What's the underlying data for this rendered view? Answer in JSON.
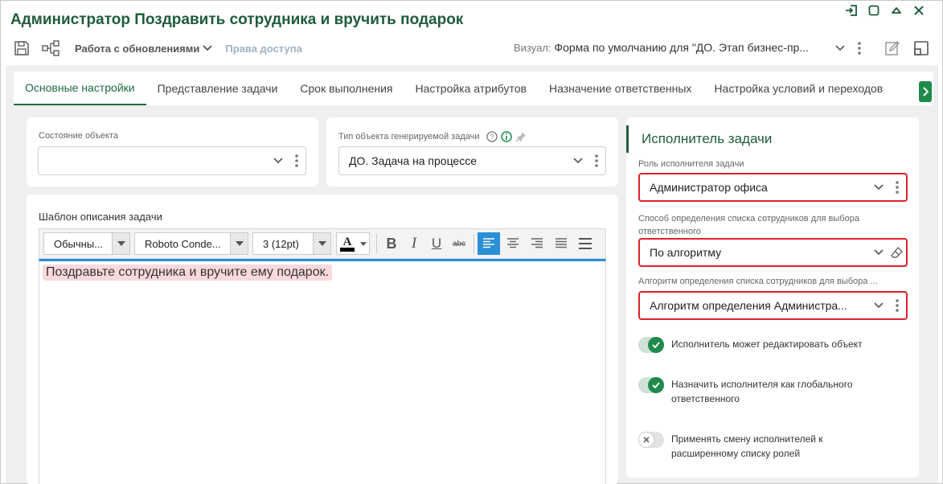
{
  "window": {
    "title": "Администратор Поздравить сотрудника и вручить подарок"
  },
  "toolbar": {
    "updates_menu": "Работа с обновлениями",
    "access_rights": "Права доступа",
    "visual_label": "Визуал:",
    "visual_value": "Форма по умолчанию для \"ДО. Этап бизнес-пр..."
  },
  "tabs": [
    {
      "label": "Основные настройки",
      "active": true
    },
    {
      "label": "Представление задачи",
      "active": false
    },
    {
      "label": "Срок выполнения",
      "active": false
    },
    {
      "label": "Настройка атрибутов",
      "active": false
    },
    {
      "label": "Назначение ответственных",
      "active": false
    },
    {
      "label": "Настройка условий и переходов",
      "active": false
    }
  ],
  "object_state": {
    "label": "Состояние объекта",
    "value": ""
  },
  "task_type": {
    "label": "Тип объекта генерируемой задачи",
    "value": "ДО. Задача на процессе"
  },
  "template": {
    "label": "Шаблон описания задачи",
    "style_value": "Обычны...",
    "font_value": "Roboto Conde...",
    "size_value": "3 (12pt)",
    "text": "Поздравьте сотрудника и вручите ему подарок."
  },
  "executor": {
    "title": "Исполнитель задачи",
    "role_label": "Роль исполнителя задачи",
    "role_value": "Администратор офиса",
    "method_label_line1": "Способ определения списка сотрудников для выбора",
    "method_label_line2": "ответственного",
    "method_value": "По алгоритму",
    "algorithm_label": "Алгоритм определения списка сотрудников для выбора ...",
    "algorithm_value": "Алгоритм определения Администра...",
    "toggles": [
      {
        "label": "Исполнитель может редактировать объект",
        "on": true
      },
      {
        "label": "Назначить исполнителя как глобального ответственного",
        "on": true
      },
      {
        "label": "Применять смену исполнителей к расширенному списку ролей",
        "on": false
      }
    ]
  },
  "colors": {
    "accent": "#1f5c3c",
    "toggle_on": "#1f8a4c",
    "highlight_border": "#e0202d",
    "editor_active": "#2a8fd6"
  }
}
